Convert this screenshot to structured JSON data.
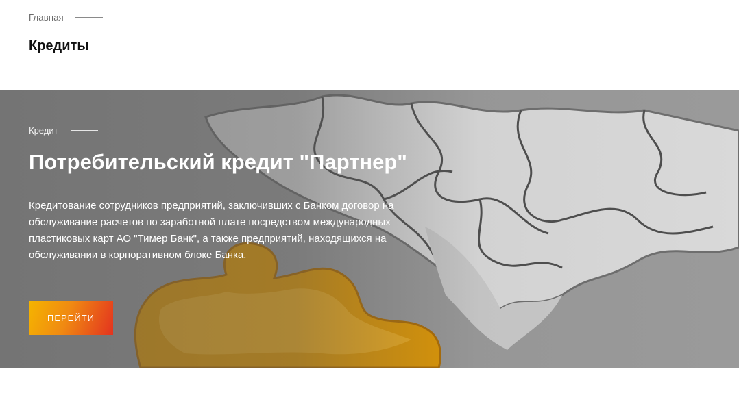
{
  "breadcrumb": {
    "home_label": "Главная"
  },
  "page": {
    "title": "Кредиты"
  },
  "hero": {
    "kicker": "Кредит",
    "title": "Потребительский кредит \"Партнер\"",
    "description": "Кредитование сотрудников предприятий, заключивших с Банком договор на обслуживание расчетов по заработной плате посредством международных пластиковых карт АО \"Тимер Банк\", а также предприятий, находящихся на обслуживании в корпоративном блоке Банка.",
    "cta_label": "ПЕРЕЙТИ",
    "image": "puzzle-pieces-image"
  },
  "colors": {
    "button_gradient": [
      "#f5b400",
      "#f08a12",
      "#e3331f"
    ],
    "puzzle_gray": "#d8d8d8",
    "puzzle_orange": "#e9a000"
  }
}
